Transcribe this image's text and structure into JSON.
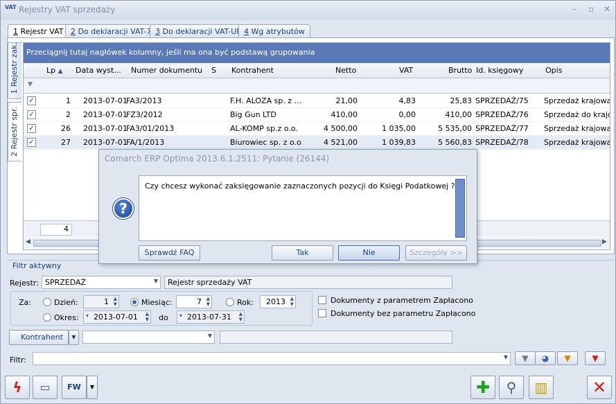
{
  "window": {
    "title": "Rejestry VAT sprzedaży",
    "app_icon_text": "VAT",
    "min_label": "–",
    "max_label": "▫",
    "close_label": "✕"
  },
  "tabs": [
    {
      "num": "1",
      "label": " Rejestr VAT"
    },
    {
      "num": "2",
      "label": " Do deklaracji VAT-7"
    },
    {
      "num": "3",
      "label": " Do deklaracji VAT-UE"
    },
    {
      "num": "4",
      "label": " Wg atrybutów"
    }
  ],
  "side_tabs": [
    {
      "label": "1 Rejestr zak."
    },
    {
      "label": "2 Rejestr spr."
    }
  ],
  "grid": {
    "group_hint": "Przeciągnij tutaj nagłówek kolumny, jeśli ma ona być podstawą grupowania",
    "columns": [
      "Lp",
      "Data wyst...",
      "Numer dokumentu",
      "S",
      "Kontrahent",
      "Netto",
      "VAT",
      "Brutto",
      "Id. księgowy",
      "Opis"
    ],
    "sort_indicator": "▲",
    "rows": [
      {
        "checked": "✓",
        "lp": "1",
        "date": "2013-07-01",
        "doc": "FA3/2013",
        "s": "",
        "contractor": "F.H. ALOZA sp. z ...",
        "netto": "21,00",
        "vat": "4,83",
        "brutto": "25,83",
        "id": "SPRZEDAŻ/75",
        "desc": "Sprzedaż krajowa"
      },
      {
        "checked": "✓",
        "lp": "2",
        "date": "2013-07-01",
        "doc": "FZ3/2012",
        "s": "",
        "contractor": "Big Gun LTD",
        "netto": "410,00",
        "vat": "0,00",
        "brutto": "410,00",
        "id": "SPRZEDAŻ/76",
        "desc": "Sprzedaż do krajów"
      },
      {
        "checked": "✓",
        "lp": "26",
        "date": "2013-07-01",
        "doc": "FA3/01/2013",
        "s": "",
        "contractor": "AL-KOMP sp.z o.o.",
        "netto": "4 500,00",
        "vat": "1 035,00",
        "brutto": "5 535,00",
        "id": "SPRZEDAŻ/77",
        "desc": "Sprzedaż krajowa"
      },
      {
        "checked": "✓",
        "lp": "27",
        "date": "2013-07-01",
        "doc": "FA/1/2013",
        "s": "",
        "contractor": "Biurowiec sp. z o.o.",
        "netto": "4 521,00",
        "vat": "1 039,83",
        "brutto": "5 560,83",
        "id": "SPRZEDAŻ/78",
        "desc": "Sprzedaż krajowa"
      }
    ],
    "footer_count": "4"
  },
  "dialog": {
    "title": "Comarch ERP Optima 2013.6.1.2511: Pytanie (26144)",
    "question_icon": "?",
    "message": "Czy chcesz wykonać zaksięgowanie zaznaczonych pozycji do Księgi Podatkowej ?",
    "btn_faq": "Sprawdź FAQ",
    "btn_yes": "Tak",
    "btn_no": "Nie",
    "btn_details": "Szczegóły >>"
  },
  "filter": {
    "title": "Filtr aktywny",
    "register_label": "Rejestr:",
    "register_value": "SPRZEDAŻ",
    "register_name": "Rejestr sprzedaży VAT",
    "za_label": "Za:",
    "day_label": "Dzień:",
    "day_value": "1",
    "month_label": "Miesiąc:",
    "month_value": "7",
    "year_label": "Rok:",
    "year_value": "2013",
    "period_label": "Okres:",
    "period_from": "2013-07-01",
    "do_label": "do",
    "period_to": "2013-07-31",
    "paid_label": "Dokumenty z parametrem Zapłacono",
    "unpaid_label": "Dokumenty bez parametru Zapłacono",
    "contractor_button": "Kontrahent",
    "contractor_value": "",
    "filter_label": "Filtr:",
    "filter_value": ""
  },
  "toolbar": {
    "fw_label": "FW"
  }
}
